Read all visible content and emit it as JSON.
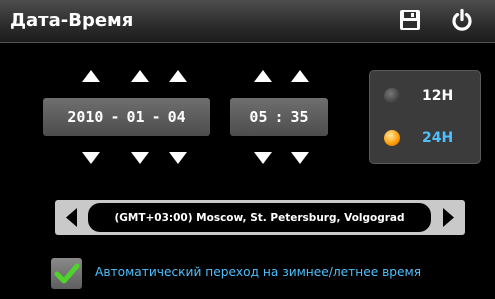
{
  "header": {
    "title": "Дата-Время",
    "save_icon": "floppy-disk-icon",
    "power_icon": "power-icon"
  },
  "date": {
    "year": "2010",
    "month": "01",
    "day": "04",
    "separator": "-"
  },
  "time": {
    "hours": "05",
    "minutes": "35",
    "separator": ":"
  },
  "time_format": {
    "options": [
      {
        "label": "12H",
        "selected": false
      },
      {
        "label": "24H",
        "selected": true
      }
    ]
  },
  "timezone": {
    "value": "(GMT+03:00) Moscow, St. Petersburg, Volgograd"
  },
  "auto_dst": {
    "label": "Автоматический переход на зимнее/летнее время",
    "checked": true
  },
  "colors": {
    "accent": "#4fc0ff",
    "radio_selected": "#ff9a00",
    "check": "#4fd22a"
  }
}
